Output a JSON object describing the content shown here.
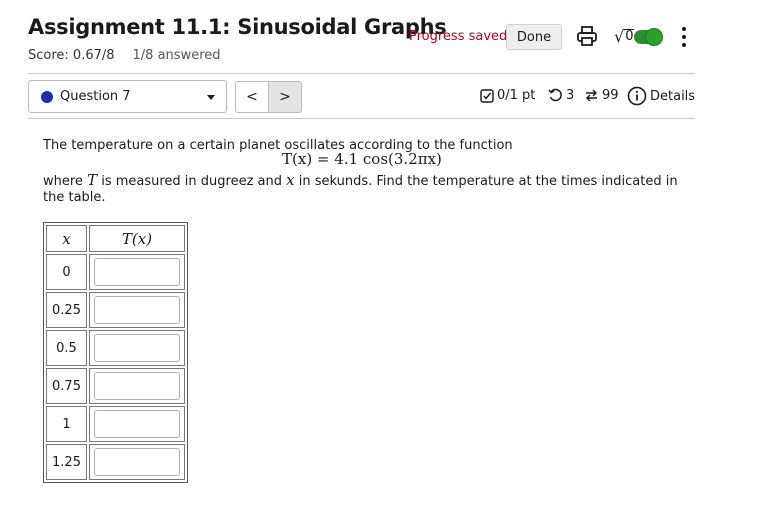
{
  "header": {
    "title": "Assignment 11.1: Sinusoidal Graphs",
    "score": "Score: 0.67/8",
    "answered": "1/8 answered",
    "progress_status": "Progress saved",
    "done_label": "Done",
    "print_icon": "printer-icon",
    "math_toggle_icon": "sqrt-icon",
    "math_toggle_sqrt_text": "0",
    "math_toggle_state": "on",
    "more_icon": "vertical-ellipsis-icon"
  },
  "question_nav": {
    "selected_question": "Question 7",
    "prev_label": "<",
    "next_label": ">",
    "points": "0/1 pt",
    "retries": "3",
    "attempts": "99",
    "details_label": "Details"
  },
  "question": {
    "intro": "The temperature on a certain planet oscillates according to the function",
    "formula": "T(x) = 4.1 cos(3.2πx)",
    "where_prefix": "where ",
    "where_var_T": "T",
    "where_mid": " is measured in dugreez and ",
    "where_var_x": "x",
    "where_suffix": " in sekunds. Find the temperature at the times indicated in",
    "where_line2": "the table."
  },
  "table": {
    "header_x": "x",
    "header_y": "T(x)",
    "rows": [
      {
        "x": "0",
        "value": ""
      },
      {
        "x": "0.25",
        "value": ""
      },
      {
        "x": "0.5",
        "value": ""
      },
      {
        "x": "0.75",
        "value": ""
      },
      {
        "x": "1",
        "value": ""
      },
      {
        "x": "1.25",
        "value": ""
      }
    ]
  },
  "colors": {
    "progress_status": "#b00020",
    "question_dot": "#1a2fb0",
    "toggle_on": "#2ba02b"
  }
}
